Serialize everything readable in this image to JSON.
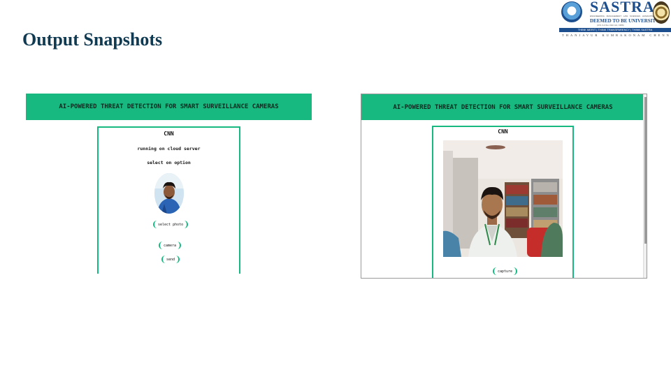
{
  "slide": {
    "title": "Output Snapshots"
  },
  "logo": {
    "name": "SASTRA",
    "tagline_small": "ENGINEERING · MANAGEMENT · LAW · SCIENCES · HUMANITIES · EDUCATION",
    "deemed": "DEEMED TO BE UNIVERSITY",
    "act": "(U/S 3 of the UGC Act, 1956)",
    "motto": "THINK MERIT | THINK TRANSPARENCY | THINK SASTRA",
    "cities": "THANJAVUR  KUMBAKONAM  CHENNAI"
  },
  "left_app": {
    "banner": "AI-POWERED THREAT DETECTION FOR SMART SURVEILLANCE CAMERAS",
    "heading": "CNN",
    "status": "running on cloud server",
    "prompt": "select on option",
    "buttons": {
      "select_photo": "select photo",
      "camera": "camera",
      "send": "send"
    }
  },
  "right_app": {
    "banner": "AI-POWERED THREAT DETECTION FOR SMART SURVEILLANCE CAMERAS",
    "heading": "CNN",
    "buttons": {
      "capture": "capture"
    }
  },
  "colors": {
    "accent": "#17b980",
    "title": "#0f3a52",
    "brand": "#1d4f8f"
  }
}
